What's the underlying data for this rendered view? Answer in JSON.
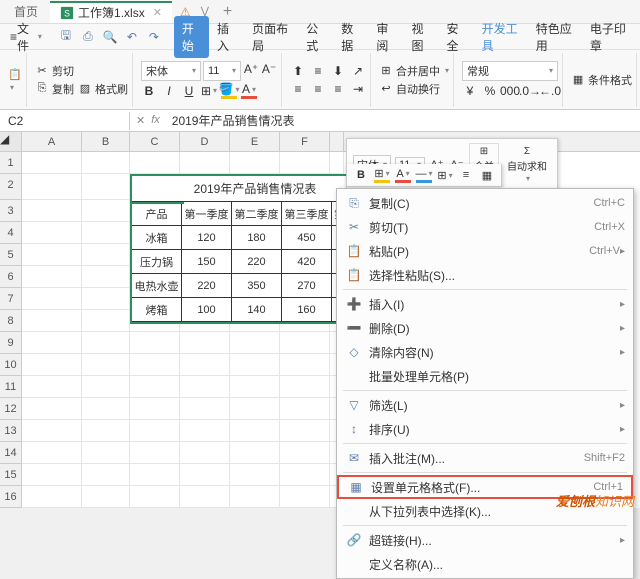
{
  "titlebar": {
    "home_tab": "首页",
    "file_tab": "工作簿1.xlsx"
  },
  "menubar": {
    "file_menu": "文件",
    "tabs": [
      "开始",
      "插入",
      "页面布局",
      "公式",
      "数据",
      "审阅",
      "视图",
      "安全",
      "开发工具",
      "特色应用",
      "电子印章"
    ]
  },
  "ribbon": {
    "cut": "剪切",
    "copy": "复制",
    "format_painter": "格式刷",
    "font_name": "宋体",
    "font_size": "11",
    "merge_center": "合并居中",
    "auto_wrap": "自动换行",
    "normal": "常规",
    "cond_fmt": "条件格式"
  },
  "namebox": {
    "ref": "C2",
    "formula": "2019年产品销售情况表"
  },
  "columns": [
    "A",
    "B",
    "C",
    "D",
    "E",
    "F"
  ],
  "rows": [
    "1",
    "2",
    "3",
    "4",
    "5",
    "6",
    "7",
    "8",
    "9",
    "10",
    "11",
    "12",
    "13",
    "14",
    "15",
    "16"
  ],
  "table": {
    "title": "2019年产品销售情况表",
    "headers": [
      "产品",
      "第一季度",
      "第二季度",
      "第三季度",
      "第"
    ],
    "rows": [
      [
        "冰箱",
        "120",
        "180",
        "450",
        ""
      ],
      [
        "压力锅",
        "150",
        "220",
        "420",
        ""
      ],
      [
        "电热水壶",
        "220",
        "350",
        "270",
        ""
      ],
      [
        "烤箱",
        "100",
        "140",
        "160",
        ""
      ]
    ]
  },
  "float_toolbar": {
    "font": "宋体",
    "size": "11",
    "merge": "合并",
    "autosum": "自动求和"
  },
  "context_menu": {
    "items": [
      {
        "icon": "copy",
        "label": "复制(C)",
        "shortcut": "Ctrl+C"
      },
      {
        "icon": "cut",
        "label": "剪切(T)",
        "shortcut": "Ctrl+X"
      },
      {
        "icon": "paste",
        "label": "粘贴(P)",
        "shortcut": "Ctrl+V",
        "arrow": true
      },
      {
        "icon": "paste-special",
        "label": "选择性粘贴(S)..."
      },
      {
        "sep": true
      },
      {
        "icon": "insert",
        "label": "插入(I)",
        "arrow": true
      },
      {
        "icon": "delete",
        "label": "删除(D)",
        "arrow": true
      },
      {
        "icon": "clear",
        "label": "清除内容(N)",
        "arrow": true
      },
      {
        "icon": "batch",
        "label": "批量处理单元格(P)"
      },
      {
        "sep": true
      },
      {
        "icon": "filter",
        "label": "筛选(L)",
        "arrow": true
      },
      {
        "icon": "sort",
        "label": "排序(U)",
        "arrow": true
      },
      {
        "sep": true
      },
      {
        "icon": "comment",
        "label": "插入批注(M)...",
        "shortcut": "Shift+F2"
      },
      {
        "sep": true
      },
      {
        "icon": "format-cell",
        "label": "设置单元格格式(F)...",
        "shortcut": "Ctrl+1",
        "highlight": true
      },
      {
        "icon": "dropdown",
        "label": "从下拉列表中选择(K)..."
      },
      {
        "sep": true
      },
      {
        "icon": "hyperlink",
        "label": "超链接(H)...",
        "arrow": true
      },
      {
        "icon": "name",
        "label": "定义名称(A)..."
      }
    ]
  },
  "watermark": {
    "brand": "爱刨根",
    "suffix": "知识网"
  }
}
